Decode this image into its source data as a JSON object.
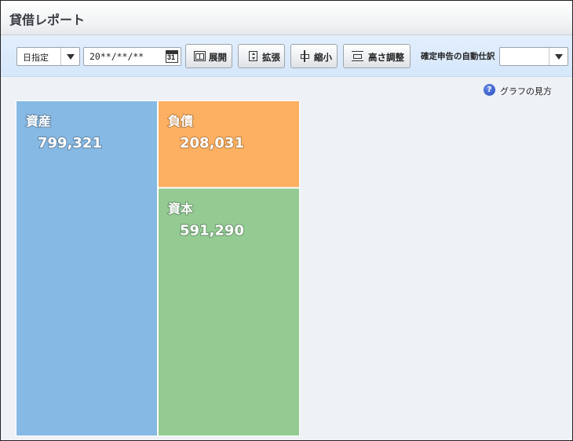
{
  "window": {
    "title": "貸借レポート"
  },
  "toolbar": {
    "period_select": {
      "value": "日指定"
    },
    "date_input": {
      "value": "20**/**/**",
      "calendar_icon_text": "31"
    },
    "buttons": [
      {
        "icon": "expand-icon",
        "label": "展開"
      },
      {
        "icon": "stretch-icon",
        "label": "拡張"
      },
      {
        "icon": "shrink-icon",
        "label": "縮小"
      },
      {
        "icon": "height-adjust-icon",
        "label": "高さ調整"
      }
    ],
    "auto_journal": {
      "label": "確定申告の自動仕訳",
      "value": ""
    }
  },
  "help": {
    "icon": "help-icon",
    "text": "グラフの見方"
  },
  "chart_data": {
    "type": "treemap",
    "segments": [
      {
        "name": "資産",
        "value": 799321,
        "display": "799,321",
        "color": "#86b9e3",
        "column": "left"
      },
      {
        "name": "負債",
        "value": 208031,
        "display": "208,031",
        "color": "#fdb061",
        "column": "right"
      },
      {
        "name": "資本",
        "value": 591290,
        "display": "591,290",
        "color": "#93cb93",
        "column": "right"
      }
    ]
  }
}
